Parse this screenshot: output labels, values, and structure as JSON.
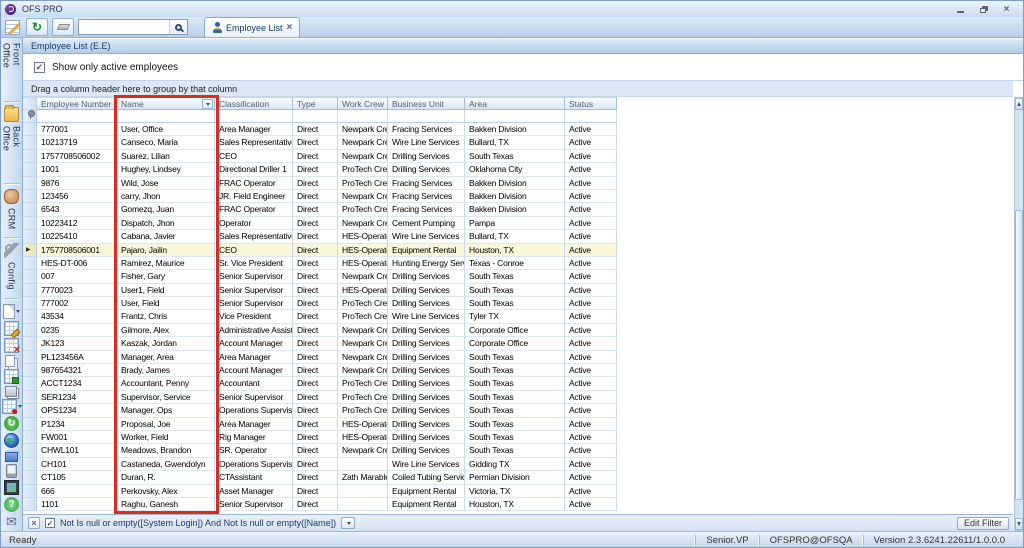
{
  "window": {
    "title": "OFS PRO"
  },
  "icons": {
    "check": "✓",
    "close": "×",
    "row_arrow": "▶",
    "refresh": "↻"
  },
  "toolbar": {
    "search_value": "",
    "tab_label": "Employee List"
  },
  "sidebar": {
    "items": [
      {
        "kind": "label",
        "name": "sidebar-group-front-office",
        "label": "Front Office"
      },
      {
        "kind": "sep"
      },
      {
        "kind": "icon",
        "name": "folder-icon"
      },
      {
        "kind": "label",
        "name": "sidebar-group-back-office",
        "label": "Back Office"
      },
      {
        "kind": "sep"
      },
      {
        "kind": "icon",
        "name": "crm-icon"
      },
      {
        "kind": "label",
        "name": "sidebar-group-crm",
        "label": "CRM"
      },
      {
        "kind": "sep"
      },
      {
        "kind": "icon",
        "name": "config-icon"
      },
      {
        "kind": "label",
        "name": "sidebar-group-config",
        "label": "Config"
      },
      {
        "kind": "sep"
      },
      {
        "kind": "icon",
        "name": "new-document-icon",
        "dropdown": true
      },
      {
        "kind": "icon",
        "name": "grid-edit-icon",
        "grid": true
      },
      {
        "kind": "icon",
        "name": "grid-delete-icon",
        "grid": true
      },
      {
        "kind": "icon",
        "name": "copy-icon"
      },
      {
        "kind": "icon",
        "name": "grid-add-icon",
        "grid": true
      },
      {
        "kind": "icon",
        "name": "layers-icon"
      },
      {
        "kind": "icon",
        "name": "grid-pin-icon",
        "grid": true,
        "dropdown": true
      },
      {
        "kind": "icon",
        "name": "sync-icon",
        "glyph": "↻"
      },
      {
        "kind": "icon",
        "name": "globe-icon"
      },
      {
        "kind": "icon",
        "name": "folders-icon"
      },
      {
        "kind": "icon",
        "name": "device-icon"
      },
      {
        "kind": "icon",
        "name": "screenshot-icon"
      },
      {
        "kind": "icon",
        "name": "help-icon",
        "glyph": "?"
      },
      {
        "kind": "icon",
        "name": "mail-icon",
        "glyph": "✉"
      }
    ]
  },
  "panel": {
    "title": "Employee List (E.E)",
    "active_checkbox_label": "Show only active employees",
    "checkbox_checked": true,
    "group_hint": "Drag a column header here to group by that column"
  },
  "grid": {
    "columns": [
      "Employee Number",
      "Name",
      "Classification",
      "Type",
      "Work Crew",
      "Business Unit",
      "Area",
      "Status"
    ],
    "highlighted_row_index": 9,
    "rows": [
      [
        "777001",
        "User, Office",
        "Area Manager",
        "Direct",
        "Newpark Crew",
        "Fracing Services",
        "Bakken Division",
        "Active"
      ],
      [
        "10213719",
        "Canseco, Maria",
        "Sales Representative",
        "Direct",
        "Newpark Crew",
        "Wire Line Services",
        "Bullard, TX",
        "Active"
      ],
      [
        "1757708506002",
        "Suarez, Lilian",
        "CEO",
        "Direct",
        "Newpark Crew",
        "Drilling Services",
        "South Texas",
        "Active"
      ],
      [
        "1001",
        "Hughey, Lindsey",
        "Directional Driller 1",
        "Direct",
        "ProTech Crew",
        "Drilling Services",
        "Oklahoma City",
        "Active"
      ],
      [
        "9876",
        "Wild, Jose",
        "FRAC Operator",
        "Direct",
        "ProTech Crew",
        "Fracing Services",
        "Bakken Division",
        "Active"
      ],
      [
        "123456",
        "carry, Jhon",
        "JR. Field Engineer",
        "Direct",
        "Newpark Crew",
        "Fracing Services",
        "Bakken Division",
        "Active"
      ],
      [
        "6543",
        "Gomezq, Juan",
        "FRAC Operator",
        "Direct",
        "ProTech Crew",
        "Fracing Services",
        "Bakken Division",
        "Active"
      ],
      [
        "10223412",
        "Dispatch, Jhon",
        "Operator",
        "Direct",
        "Newpark Crew",
        "Cement Pumping",
        "Pampa",
        "Active"
      ],
      [
        "10225410",
        "Cabana, Javier",
        "Sales Representative",
        "Direct",
        "HES-Operators",
        "Wire Line Services",
        "Bullard, TX",
        "Active"
      ],
      [
        "1757708506001",
        "Pajaro, Jailin",
        "CEO",
        "Direct",
        "HES-Operators",
        "Equipment Rental",
        "Houston, TX",
        "Active"
      ],
      [
        "HES-DT-006",
        "Ramirez, Maurice",
        "Sr. Vice President",
        "Direct",
        "HES-Operators",
        "Hunting Energy Servi...",
        "Texas - Conroe",
        "Active"
      ],
      [
        "007",
        "Fisher, Gary",
        "Senior Supervisor",
        "Direct",
        "Newpark Crew",
        "Drilling Services",
        "South Texas",
        "Active"
      ],
      [
        "7770023",
        "User1, Field",
        "Senior Supervisor",
        "Direct",
        "HES-Operators",
        "Drilling Services",
        "South Texas",
        "Active"
      ],
      [
        "777002",
        "User, Field",
        "Senior Supervisor",
        "Direct",
        "ProTech Crew",
        "Drilling Services",
        "South Texas",
        "Active"
      ],
      [
        "43534",
        "Frantz, Chris",
        "Vice President",
        "Direct",
        "ProTech Crew",
        "Wire Line Services",
        "Tyler TX",
        "Active"
      ],
      [
        "0235",
        "Gilmore, Alex",
        "Administrative Assistant",
        "Direct",
        "Newpark Crew",
        "Drilling Services",
        "Corporate Office",
        "Active"
      ],
      [
        "JK123",
        "Kaszak, Jordan",
        "Account Manager",
        "Direct",
        "Newpark Crew",
        "Drilling Services",
        "Corporate Office",
        "Active"
      ],
      [
        "PL123456A",
        "Manager, Area",
        "Area Manager",
        "Direct",
        "Newpark Crew",
        "Drilling Services",
        "South Texas",
        "Active"
      ],
      [
        "987654321",
        "Brady, James",
        "Account Manager",
        "Direct",
        "Newpark Crew",
        "Drilling Services",
        "South Texas",
        "Active"
      ],
      [
        "ACCT1234",
        "Accountant, Penny",
        "Accountant",
        "Direct",
        "ProTech Crew",
        "Drilling Services",
        "South Texas",
        "Active"
      ],
      [
        "SER1234",
        "Supervisor, Service",
        "Senior Supervisor",
        "Direct",
        "ProTech Crew",
        "Drilling Services",
        "South Texas",
        "Active"
      ],
      [
        "OPS1234",
        "Manager, Ops",
        "Operations Supervisor",
        "Direct",
        "ProTech Crew",
        "Drilling Services",
        "South Texas",
        "Active"
      ],
      [
        "P1234",
        "Proposal, Joe",
        "Area Manager",
        "Direct",
        "HES-Operators",
        "Drilling Services",
        "South Texas",
        "Active"
      ],
      [
        "FW001",
        "Worker, Field",
        "Rig Manager",
        "Direct",
        "HES-Operators",
        "Drilling Services",
        "South Texas",
        "Active"
      ],
      [
        "CHWL101",
        "Meadows, Brandon",
        "SR. Operator",
        "Direct",
        "Newpark Crew",
        "Drilling Services",
        "South Texas",
        "Active"
      ],
      [
        "CH101",
        "Castaneda, Gwendolyn",
        "Operations Supervisor",
        "Direct",
        "",
        "Wire Line Services",
        "Gidding TX",
        "Active"
      ],
      [
        "CT105",
        "Duran, R.",
        "CTAssistant",
        "Direct",
        "Zath Marable'...",
        "Coiled Tubing Services",
        "Permian Division",
        "Active"
      ],
      [
        "666",
        "Perkovsky, Alex",
        "Asset Manager",
        "Direct",
        "",
        "Equipment Rental",
        "Victoria, TX",
        "Active"
      ],
      [
        "1101",
        "Raghu, Ganesh",
        "Senior Supervisor",
        "Direct",
        "",
        "Equipment Rental",
        "Houston, TX",
        "Active"
      ]
    ]
  },
  "filter_bar": {
    "checked": true,
    "expression": "Not Is null or empty([System Login]) And Not Is null or empty([Name])",
    "edit_button_label": "Edit Filter"
  },
  "statusbar": {
    "ready": "Ready",
    "right": [
      "Senior.VP",
      "OFSPRO@OFSQA",
      "Version 2.3.6241.22611/1.0.0.0"
    ]
  },
  "colors": {
    "annotation_red": "#dd2a1f",
    "row_highlight": "#faf8da"
  }
}
